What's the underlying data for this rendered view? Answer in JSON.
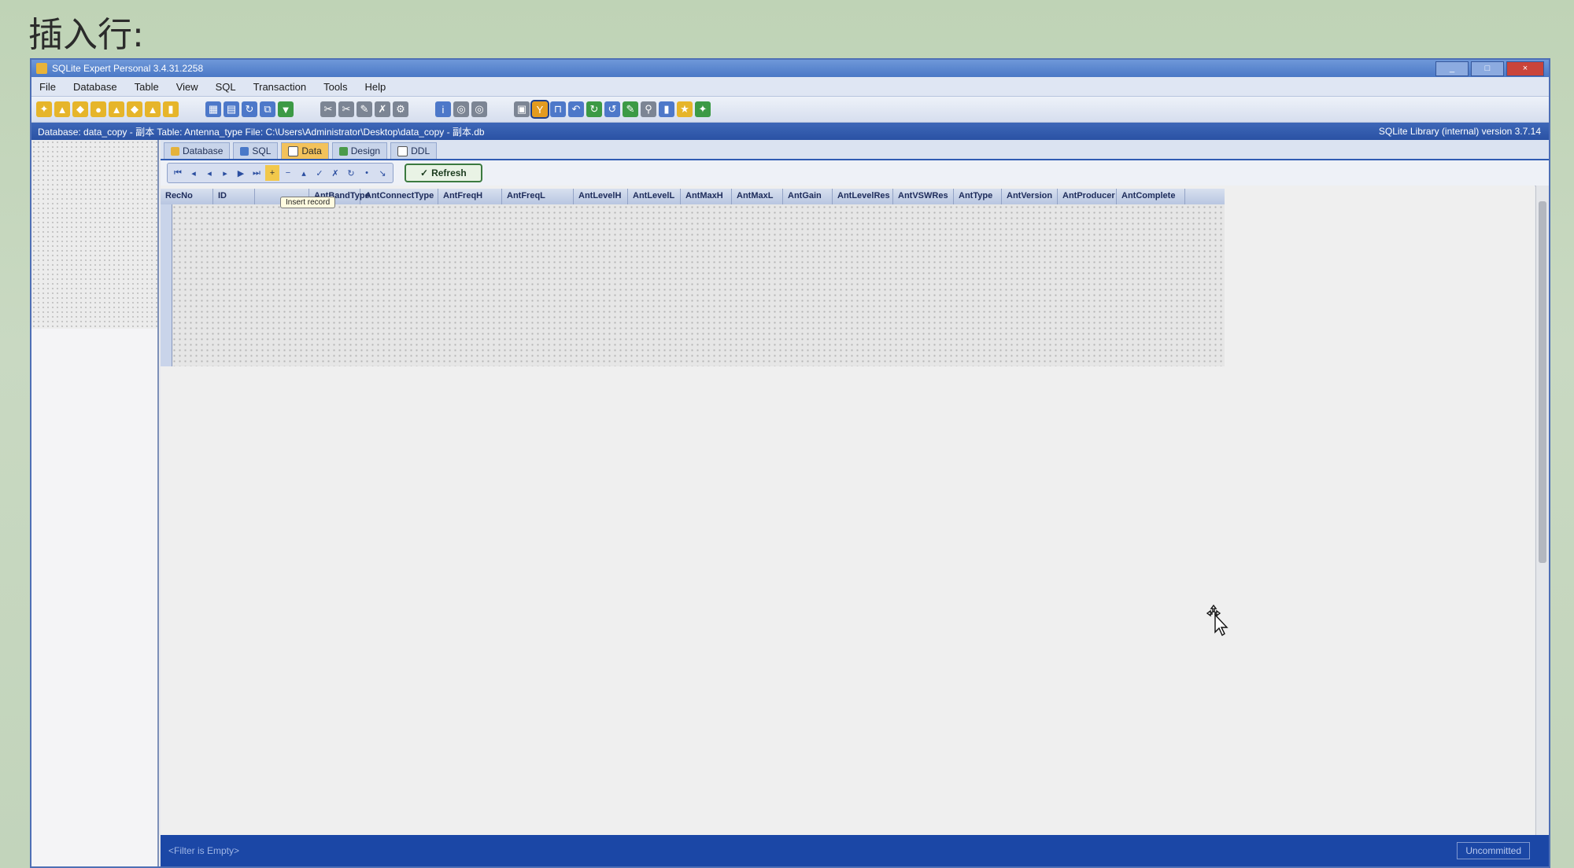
{
  "heading": "插入行:",
  "window": {
    "title": "SQLite Expert Personal 3.4.31.2258",
    "controls": [
      "_",
      "□",
      "×"
    ]
  },
  "menu": [
    "File",
    "Database",
    "Table",
    "View",
    "SQL",
    "Transaction",
    "Tools",
    "Help"
  ],
  "toolbar_groups": [
    {
      "count": 8,
      "color": "yellow"
    },
    {
      "count": 5,
      "color": "blue"
    },
    {
      "count": 5,
      "color": "gray"
    },
    {
      "count": 3,
      "color": "blue"
    },
    {
      "count": 11,
      "color": "mixed"
    }
  ],
  "path_bar": {
    "text": "Database: data_copy - 副本   Table: Antenna_type   File: C:\\Users\\Administrator\\Desktop\\data_copy - 副本.db",
    "library_version": "SQLite Library (internal) version 3.7.14"
  },
  "tabs": [
    {
      "label": "Database",
      "active": false,
      "color": "#e4b23b"
    },
    {
      "label": "SQL",
      "active": false,
      "color": "#4a79c8"
    },
    {
      "label": "Data",
      "active": true,
      "color": "#ffffff"
    },
    {
      "label": "Design",
      "active": false,
      "color": "#4a9a4a"
    },
    {
      "label": "DDL",
      "active": false,
      "color": "#ffffff"
    }
  ],
  "nav_buttons": [
    "⏮",
    "◂",
    "◂",
    "▸",
    "▶",
    "⏭",
    "+",
    "−",
    "▴",
    "✓",
    "✗",
    "↻",
    "•",
    "↘"
  ],
  "refresh_label": "Refresh",
  "tooltip": "Insert record",
  "grid_columns": [
    "RecNo",
    "ID",
    "",
    "AntBandType",
    "AntConnectType",
    "AntFreqH",
    "AntFreqL",
    "AntLevelH",
    "AntLevelL",
    "AntMaxH",
    "AntMaxL",
    "AntGain",
    "AntLevelRes",
    "AntVSWRes",
    "AntType",
    "AntVersion",
    "AntProducer",
    "AntComplete"
  ],
  "status": {
    "left": "<Filter is Empty>",
    "right": "Uncommitted"
  },
  "icons": {
    "cursor": "move-cursor-icon"
  }
}
